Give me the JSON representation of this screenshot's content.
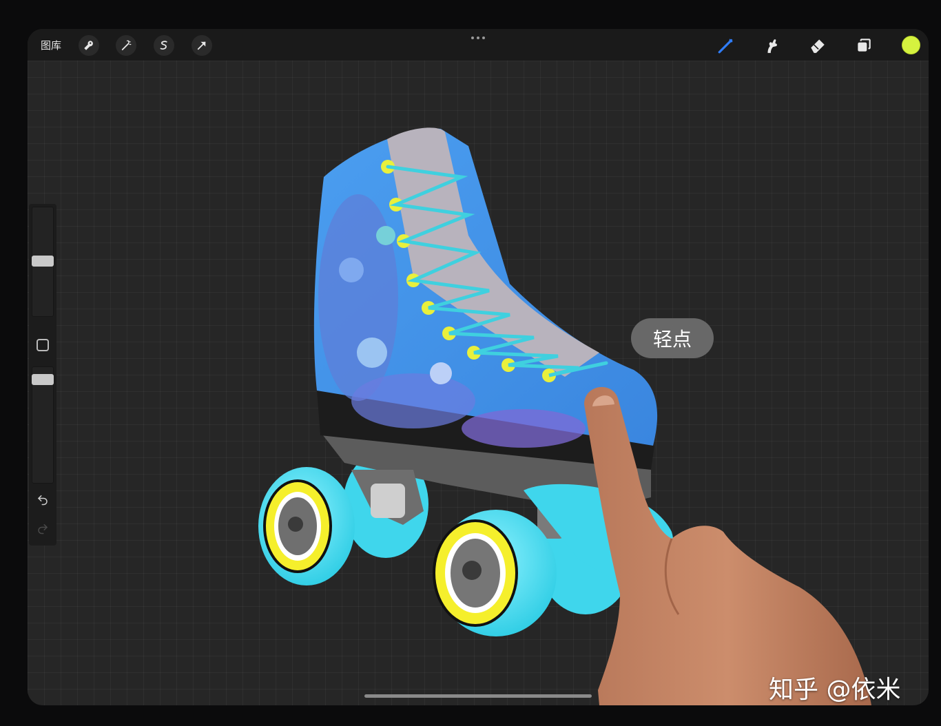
{
  "topbar": {
    "gallery_label": "图库",
    "left_tools": [
      "wrench-icon",
      "magic-wand-icon",
      "selection-icon",
      "transform-arrow-icon"
    ],
    "right_tools": [
      "brush-icon",
      "smudge-icon",
      "eraser-icon",
      "layers-icon"
    ],
    "current_color": "#d5f23f",
    "accent": "#2f7cf6"
  },
  "sidebar": {
    "tools": [
      "brush-size-slider",
      "modify-button",
      "opacity-slider",
      "undo-icon",
      "redo-icon"
    ]
  },
  "tooltip": {
    "text": "轻点"
  },
  "watermark": {
    "text": "知乎 @依米"
  }
}
